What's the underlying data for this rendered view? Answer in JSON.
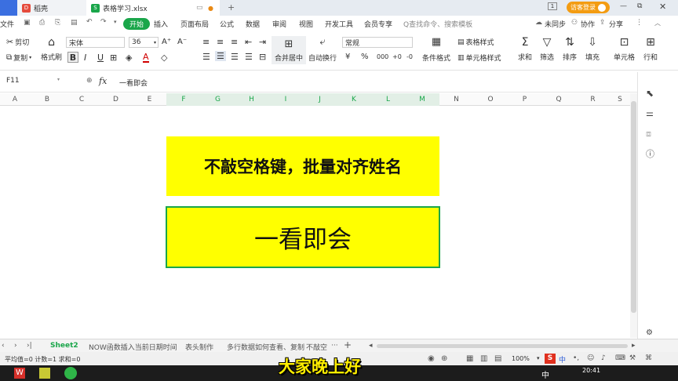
{
  "titlebar": {
    "tab1": "",
    "tab2": "稻壳",
    "tab3": "表格学习.xlsx",
    "login": "访客登录"
  },
  "menu": {
    "file": "文件",
    "items": [
      "开始",
      "插入",
      "页面布局",
      "公式",
      "数据",
      "审阅",
      "视图",
      "开发工具",
      "会员专享"
    ],
    "search": "Q查找命令、搜索模板",
    "sync": "未同步",
    "collab": "协作",
    "share": "分享"
  },
  "ribbon": {
    "cut": "剪切",
    "copy": "复制",
    "painter": "格式刷",
    "font": "宋体",
    "size": "36",
    "bold": "B",
    "italic": "I",
    "underline": "U",
    "merge": "合并居中",
    "wrap": "自动换行",
    "numfmt": "常规",
    "cond": "条件格式",
    "tablestyle": "表格样式",
    "cellstyle": "单元格样式",
    "sum": "求和",
    "filter": "筛选",
    "sort": "排序",
    "fill": "填充",
    "cell": "单元格",
    "rowcol": "行和"
  },
  "formula": {
    "cellref": "F11",
    "fx": "fx",
    "content": "一看即会"
  },
  "columns": [
    "A",
    "B",
    "C",
    "D",
    "E",
    "F",
    "G",
    "H",
    "I",
    "J",
    "K",
    "L",
    "M",
    "N",
    "O",
    "P",
    "Q",
    "R",
    "S"
  ],
  "content": {
    "box1": "不敲空格键，批量对齐姓名",
    "box2": "一看即会"
  },
  "sheets": {
    "tabs": [
      "Sheet2",
      "NOW函数插入当前日期时间",
      "表头制作",
      "多行数据如何查看、复制",
      "不敲空"
    ],
    "more": "···",
    "add": "+"
  },
  "status": {
    "stats": "平均值=0  计数=1  求和=0",
    "zoom": "100%"
  },
  "subtitle": "大家晚上好",
  "taskbar": {
    "time": "20:41",
    "ime": "中"
  },
  "colors": {
    "accent": "#1aa64a",
    "highlight": "#ffff00"
  }
}
